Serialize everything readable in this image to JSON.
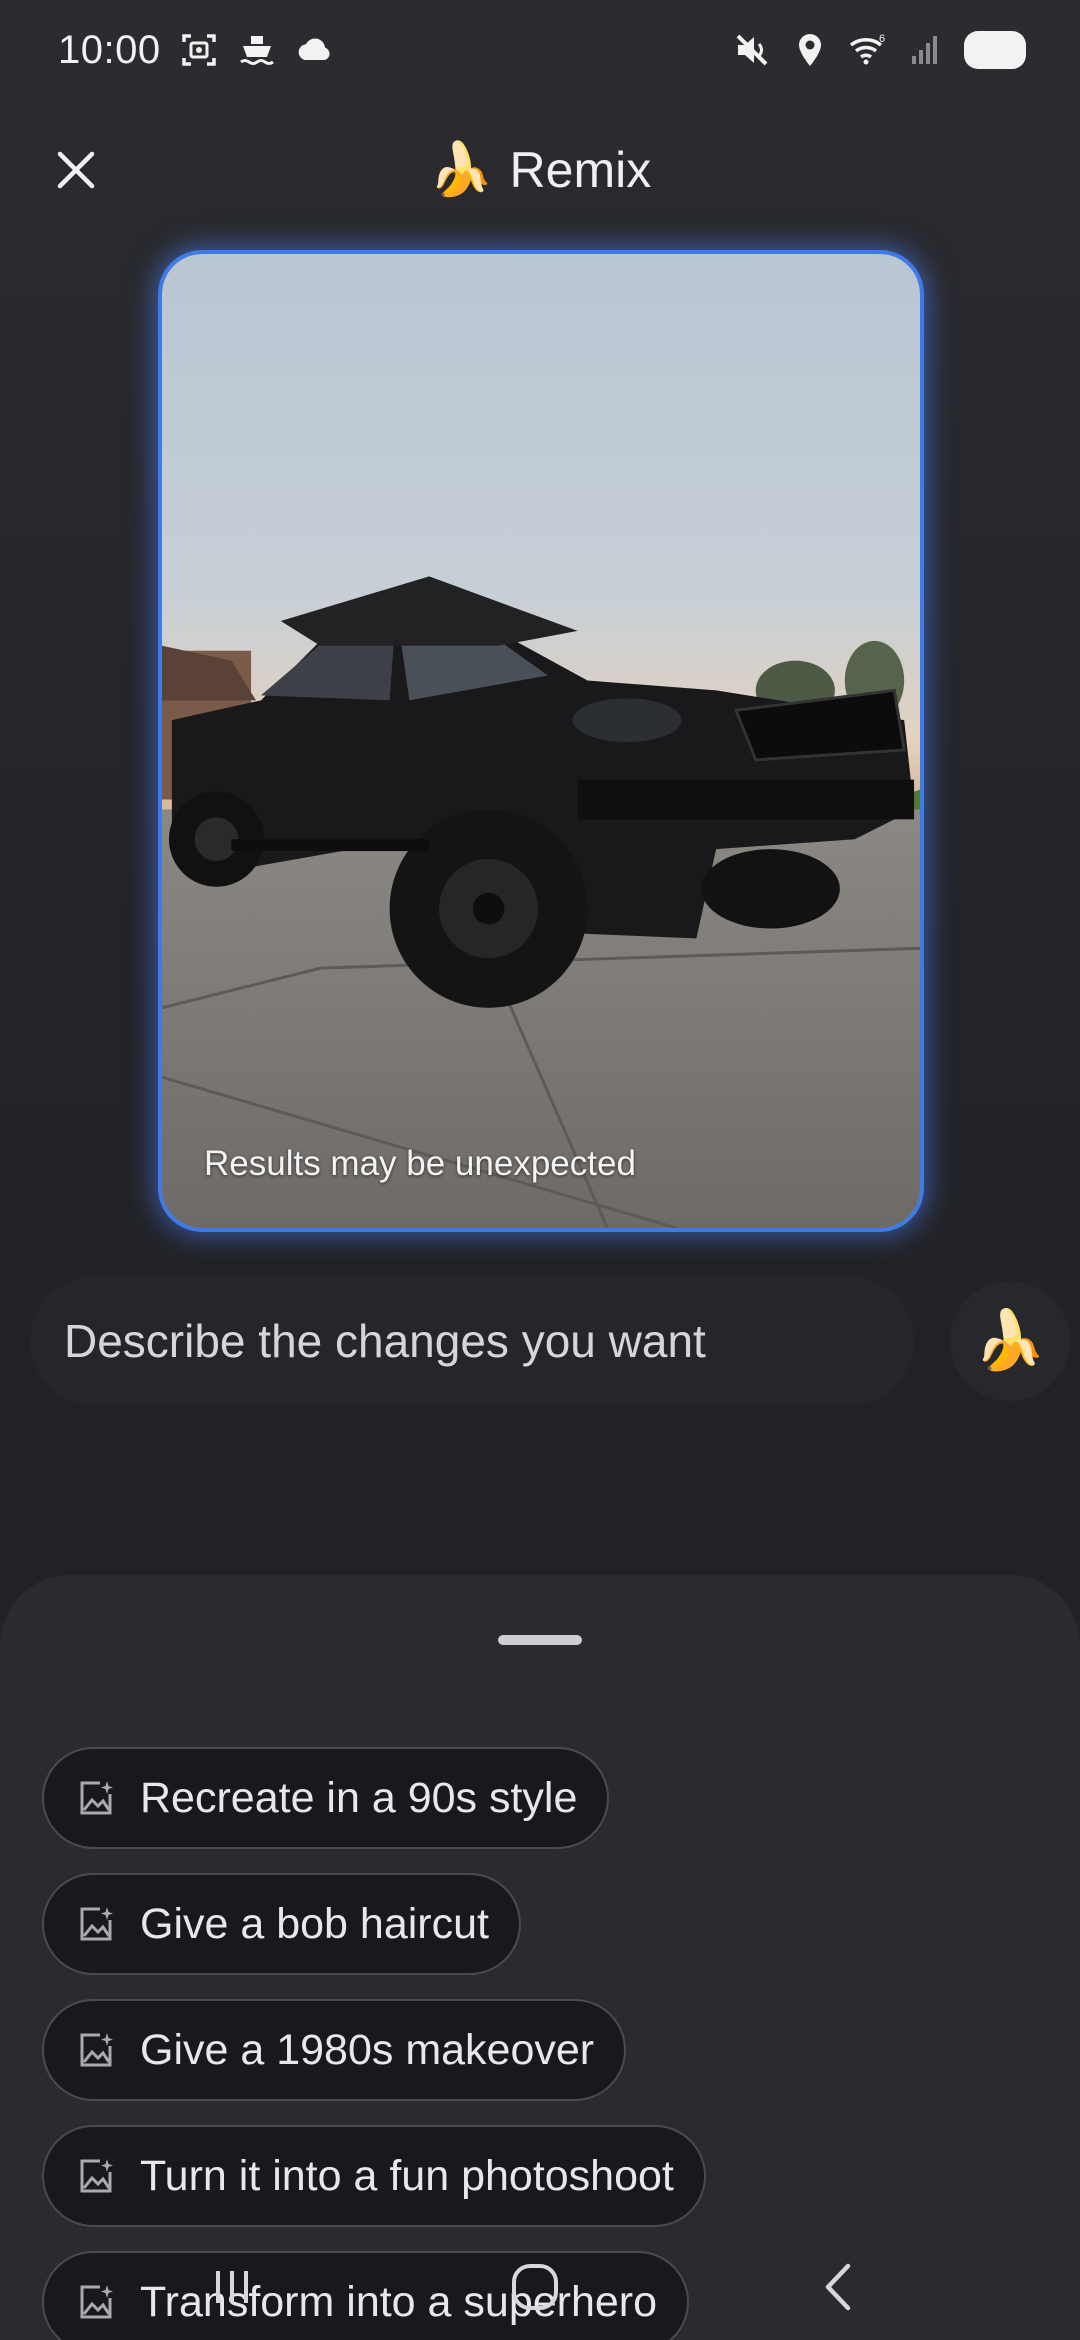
{
  "status_bar": {
    "time": "10:00",
    "left_icons": [
      "screenshot-icon",
      "ferry-icon",
      "cloud-icon"
    ],
    "right_icons": [
      "mute-icon",
      "location-icon",
      "wifi-6-icon",
      "signal-icon",
      "battery-icon"
    ]
  },
  "header": {
    "emoji": "🍌",
    "title": "Remix",
    "close_icon": "close-icon"
  },
  "image_card": {
    "note": "Results may be unexpected",
    "accent_color": "#3f7be8"
  },
  "prompt": {
    "placeholder": "Describe the changes you want",
    "send_emoji": "🍌"
  },
  "suggestions": [
    {
      "label": "Recreate in a 90s style",
      "icon": "ai-image-icon"
    },
    {
      "label": "Give a bob haircut",
      "icon": "ai-image-icon"
    },
    {
      "label": "Give a 1980s makeover",
      "icon": "ai-image-icon"
    },
    {
      "label": "Turn it into a fun photoshoot",
      "icon": "ai-image-icon"
    },
    {
      "label": "Transform into a superhero",
      "icon": "ai-image-icon"
    }
  ],
  "nav_bar": {
    "buttons": [
      "recents-icon",
      "home-icon",
      "back-icon"
    ]
  }
}
